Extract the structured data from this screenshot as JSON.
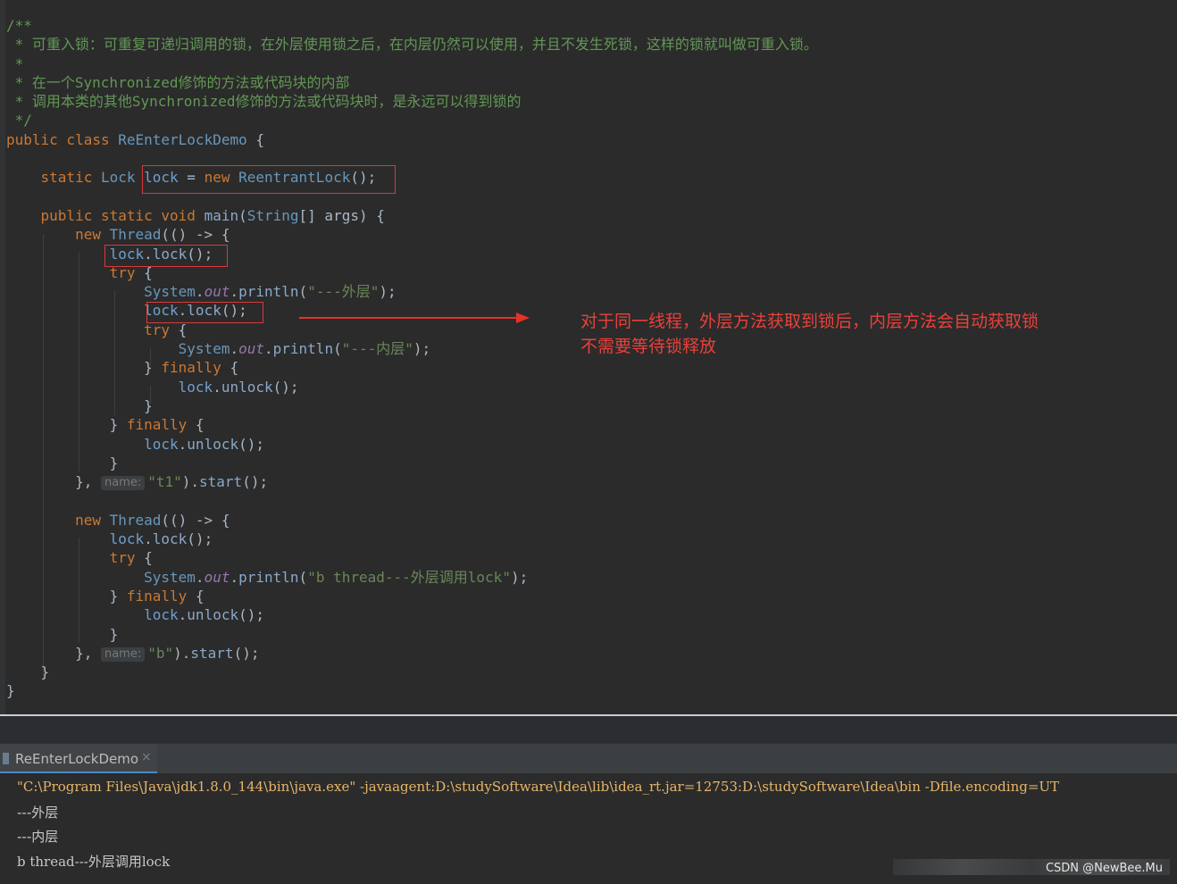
{
  "editor": {
    "lines": [
      [
        {
          "c": "comment",
          "t": "/**"
        }
      ],
      [
        {
          "c": "comment",
          "t": " * 可重入锁：可重复可递归调用的锁，在外层使用锁之后，在内层仍然可以使用，并且不发生死锁，这样的锁就叫做可重入锁。"
        }
      ],
      [
        {
          "c": "comment",
          "t": " *"
        }
      ],
      [
        {
          "c": "comment",
          "t": " * 在一个Synchronized修饰的方法或代码块的内部"
        }
      ],
      [
        {
          "c": "comment",
          "t": " * 调用本类的其他Synchronized修饰的方法或代码块时，是永远可以得到锁的"
        }
      ],
      [
        {
          "c": "comment",
          "t": " */"
        }
      ],
      [
        {
          "c": "kw",
          "t": "public class "
        },
        {
          "c": "cls",
          "t": "ReEnterLockDemo"
        },
        {
          "c": "plain",
          "t": " {"
        }
      ],
      [],
      [
        {
          "c": "plain",
          "t": "    "
        },
        {
          "c": "kw",
          "t": "static "
        },
        {
          "c": "cls",
          "t": "Lock "
        },
        {
          "c": "var",
          "t": "lock"
        },
        {
          "c": "plain",
          "t": " = "
        },
        {
          "c": "kw",
          "t": "new "
        },
        {
          "c": "cls",
          "t": "ReentrantLock"
        },
        {
          "c": "plain",
          "t": "();"
        }
      ],
      [],
      [
        {
          "c": "plain",
          "t": "    "
        },
        {
          "c": "kw",
          "t": "public static void "
        },
        {
          "c": "method",
          "t": "main"
        },
        {
          "c": "plain",
          "t": "("
        },
        {
          "c": "cls",
          "t": "String"
        },
        {
          "c": "plain",
          "t": "[] args) {"
        }
      ],
      [
        {
          "c": "plain",
          "t": "        "
        },
        {
          "c": "kw",
          "t": "new "
        },
        {
          "c": "cls",
          "t": "Thread"
        },
        {
          "c": "plain",
          "t": "(() -> {"
        }
      ],
      [
        {
          "c": "plain",
          "t": "            "
        },
        {
          "c": "var",
          "t": "lock"
        },
        {
          "c": "plain",
          "t": "."
        },
        {
          "c": "method",
          "t": "lock"
        },
        {
          "c": "plain",
          "t": "();"
        }
      ],
      [
        {
          "c": "plain",
          "t": "            "
        },
        {
          "c": "kw",
          "t": "try"
        },
        {
          "c": "plain",
          "t": " {"
        }
      ],
      [
        {
          "c": "plain",
          "t": "                "
        },
        {
          "c": "cls",
          "t": "System"
        },
        {
          "c": "plain",
          "t": "."
        },
        {
          "c": "field",
          "t": "out"
        },
        {
          "c": "plain",
          "t": "."
        },
        {
          "c": "method",
          "t": "println"
        },
        {
          "c": "plain",
          "t": "("
        },
        {
          "c": "str",
          "t": "\"---外层\""
        },
        {
          "c": "plain",
          "t": ");"
        }
      ],
      [
        {
          "c": "plain",
          "t": "                "
        },
        {
          "c": "var",
          "t": "lock"
        },
        {
          "c": "plain",
          "t": "."
        },
        {
          "c": "method",
          "t": "lock"
        },
        {
          "c": "plain",
          "t": "();"
        }
      ],
      [
        {
          "c": "plain",
          "t": "                "
        },
        {
          "c": "kw",
          "t": "try"
        },
        {
          "c": "plain",
          "t": " {"
        }
      ],
      [
        {
          "c": "plain",
          "t": "                    "
        },
        {
          "c": "cls",
          "t": "System"
        },
        {
          "c": "plain",
          "t": "."
        },
        {
          "c": "field",
          "t": "out"
        },
        {
          "c": "plain",
          "t": "."
        },
        {
          "c": "method",
          "t": "println"
        },
        {
          "c": "plain",
          "t": "("
        },
        {
          "c": "str",
          "t": "\"---内层\""
        },
        {
          "c": "plain",
          "t": ");"
        }
      ],
      [
        {
          "c": "plain",
          "t": "                } "
        },
        {
          "c": "kw",
          "t": "finally"
        },
        {
          "c": "plain",
          "t": " {"
        }
      ],
      [
        {
          "c": "plain",
          "t": "                    "
        },
        {
          "c": "var",
          "t": "lock"
        },
        {
          "c": "plain",
          "t": "."
        },
        {
          "c": "method",
          "t": "unlock"
        },
        {
          "c": "plain",
          "t": "();"
        }
      ],
      [
        {
          "c": "plain",
          "t": "                }"
        }
      ],
      [
        {
          "c": "plain",
          "t": "            } "
        },
        {
          "c": "kw",
          "t": "finally"
        },
        {
          "c": "plain",
          "t": " {"
        }
      ],
      [
        {
          "c": "plain",
          "t": "                "
        },
        {
          "c": "var",
          "t": "lock"
        },
        {
          "c": "plain",
          "t": "."
        },
        {
          "c": "method",
          "t": "unlock"
        },
        {
          "c": "plain",
          "t": "();"
        }
      ],
      [
        {
          "c": "plain",
          "t": "            }"
        }
      ],
      [
        {
          "c": "plain",
          "t": "        }, "
        },
        {
          "c": "hint",
          "t": "name:"
        },
        {
          "c": "str",
          "t": "\"t1\""
        },
        {
          "c": "plain",
          "t": ")."
        },
        {
          "c": "method",
          "t": "start"
        },
        {
          "c": "plain",
          "t": "();"
        }
      ],
      [],
      [
        {
          "c": "plain",
          "t": "        "
        },
        {
          "c": "kw",
          "t": "new "
        },
        {
          "c": "cls",
          "t": "Thread"
        },
        {
          "c": "plain",
          "t": "(() -> {"
        }
      ],
      [
        {
          "c": "plain",
          "t": "            "
        },
        {
          "c": "var",
          "t": "lock"
        },
        {
          "c": "plain",
          "t": "."
        },
        {
          "c": "method",
          "t": "lock"
        },
        {
          "c": "plain",
          "t": "();"
        }
      ],
      [
        {
          "c": "plain",
          "t": "            "
        },
        {
          "c": "kw",
          "t": "try"
        },
        {
          "c": "plain",
          "t": " {"
        }
      ],
      [
        {
          "c": "plain",
          "t": "                "
        },
        {
          "c": "cls",
          "t": "System"
        },
        {
          "c": "plain",
          "t": "."
        },
        {
          "c": "field",
          "t": "out"
        },
        {
          "c": "plain",
          "t": "."
        },
        {
          "c": "method",
          "t": "println"
        },
        {
          "c": "plain",
          "t": "("
        },
        {
          "c": "str",
          "t": "\"b thread---外层调用lock\""
        },
        {
          "c": "plain",
          "t": ");"
        }
      ],
      [
        {
          "c": "plain",
          "t": "            } "
        },
        {
          "c": "kw",
          "t": "finally"
        },
        {
          "c": "plain",
          "t": " {"
        }
      ],
      [
        {
          "c": "plain",
          "t": "                "
        },
        {
          "c": "var",
          "t": "lock"
        },
        {
          "c": "plain",
          "t": "."
        },
        {
          "c": "method",
          "t": "unlock"
        },
        {
          "c": "plain",
          "t": "();"
        }
      ],
      [
        {
          "c": "plain",
          "t": "            }"
        }
      ],
      [
        {
          "c": "plain",
          "t": "        }, "
        },
        {
          "c": "hint",
          "t": "name:"
        },
        {
          "c": "str",
          "t": "\"b\""
        },
        {
          "c": "plain",
          "t": ")."
        },
        {
          "c": "method",
          "t": "start"
        },
        {
          "c": "plain",
          "t": "();"
        }
      ],
      [
        {
          "c": "plain",
          "t": "    }"
        }
      ],
      [
        {
          "c": "plain",
          "t": "}"
        }
      ]
    ]
  },
  "annotation": {
    "line1": "对于同一线程，外层方法获取到锁后，内层方法会自动获取锁",
    "line2": "不需要等待锁释放"
  },
  "run_panel": {
    "tab_label": "ReEnterLockDemo",
    "close_glyph": "×",
    "console": [
      "\"C:\\Program Files\\Java\\jdk1.8.0_144\\bin\\java.exe\" -javaagent:D:\\studySoftware\\Idea\\lib\\idea_rt.jar=12753:D:\\studySoftware\\Idea\\bin -Dfile.encoding=UT",
      "---外层",
      "---内层",
      "b thread---外层调用lock"
    ]
  },
  "watermark": "CSDN @NewBee.Mu",
  "colors": {
    "keyword": "#cc7832",
    "class": "#6897bb",
    "string": "#6a8759",
    "comment": "#629755",
    "annotation_red": "#e5332a"
  }
}
